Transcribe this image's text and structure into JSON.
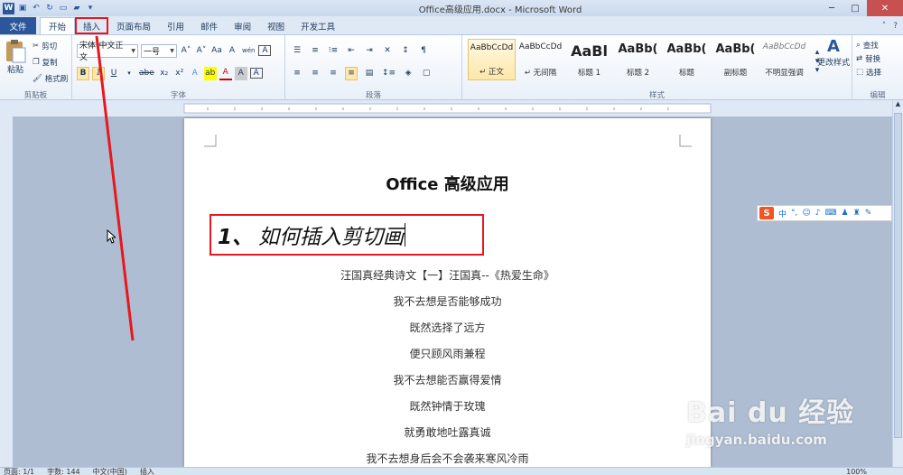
{
  "window": {
    "title": "Office高级应用.docx - Microsoft Word",
    "app_icon": "W",
    "controls": [
      "─",
      "□",
      "✕"
    ]
  },
  "tabs": [
    {
      "label": "文件",
      "style": "file"
    },
    {
      "label": "开始",
      "style": "active"
    },
    {
      "label": "插入",
      "style": "hl"
    },
    {
      "label": "页面布局",
      "style": ""
    },
    {
      "label": "引用",
      "style": ""
    },
    {
      "label": "邮件",
      "style": ""
    },
    {
      "label": "审阅",
      "style": ""
    },
    {
      "label": "视图",
      "style": ""
    },
    {
      "label": "开发工具",
      "style": ""
    }
  ],
  "ribbon": {
    "clipboard": {
      "label": "剪贴板",
      "paste": "粘贴",
      "cut": "剪切",
      "copy": "复制",
      "format_painter": "格式刷"
    },
    "font": {
      "label": "字体",
      "font_name": "宋体(中文正文",
      "font_size": "一号",
      "bold": "B",
      "italic": "I",
      "underline": "U",
      "strike": "abe",
      "subscript": "x₂",
      "superscript": "x²",
      "grow": "A˄",
      "shrink": "A˅",
      "change_case": "Aa",
      "clear": "A",
      "phonetic": "wén",
      "enclosed": "A"
    },
    "paragraph": {
      "label": "段落"
    },
    "styles": {
      "label": "样式",
      "items": [
        {
          "preview": "AaBbCcDd",
          "name": "↵ 正文",
          "selected": true
        },
        {
          "preview": "AaBbCcDd",
          "name": "↵ 无间隔",
          "selected": false
        },
        {
          "preview": "AaBl",
          "name": "标题 1",
          "selected": false
        },
        {
          "preview": "AaBb(",
          "name": "标题 2",
          "selected": false
        },
        {
          "preview": "AaBb(",
          "name": "标题",
          "selected": false
        },
        {
          "preview": "AaBb(",
          "name": "副标题",
          "selected": false
        },
        {
          "preview": "AaBbCcDd",
          "name": "不明显强调",
          "selected": false
        }
      ],
      "change_styles": "更改样式"
    },
    "editing": {
      "label": "编辑",
      "find": "查找",
      "replace": "替换",
      "select": "选择"
    }
  },
  "document": {
    "title": "Office 高级应用",
    "heading_number": "1、",
    "heading_text": "如何插入剪切画",
    "lines": [
      "汪国真经典诗文【一】汪国真--《热爱生命》",
      "我不去想是否能够成功",
      "既然选择了远方",
      "便只顾风雨兼程",
      "我不去想能否赢得爱情",
      "既然钟情于玫瑰",
      "就勇敢地吐露真诚",
      "我不去想身后会不会袭来寒风冷雨"
    ]
  },
  "ime": {
    "logo": "S",
    "mode": "中"
  },
  "statusbar": {
    "page": "页面: 1/1",
    "words": "字数: 144",
    "language": "中文(中国)",
    "mode": "插入",
    "zoom": "100%"
  },
  "watermark": {
    "main": "Bai du 经验",
    "sub": "jingyan.baidu.com"
  },
  "colors": {
    "highlight": "#e8171e",
    "file_tab": "#2b579a",
    "selected_style": "#fde7a9"
  }
}
